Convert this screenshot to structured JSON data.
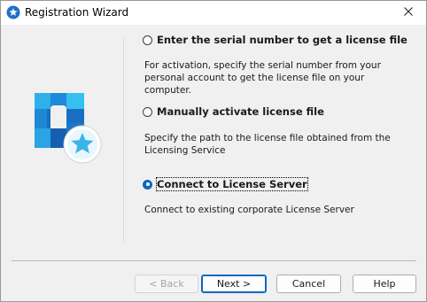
{
  "window": {
    "title": "Registration Wizard"
  },
  "icons": {
    "title": "star-badge-icon",
    "close": "close-icon",
    "logo": "product-logo-icon"
  },
  "options": [
    {
      "label": "Enter the serial number to get a license file",
      "description": "For activation, specify the serial number from your personal account to get the license file on your computer.",
      "selected": false
    },
    {
      "label": "Manually activate license file",
      "description": "Specify the path to the license file obtained from the Licensing Service",
      "selected": false
    },
    {
      "label": "Connect to License Server",
      "description": "Connect to existing corporate License Server",
      "selected": true
    }
  ],
  "buttons": {
    "back": "< Back",
    "next": "Next >",
    "cancel": "Cancel",
    "help": "Help"
  },
  "colors": {
    "accent": "#0b67c2",
    "logo_dark": "#1565b8",
    "logo_light": "#2fb0e8"
  }
}
